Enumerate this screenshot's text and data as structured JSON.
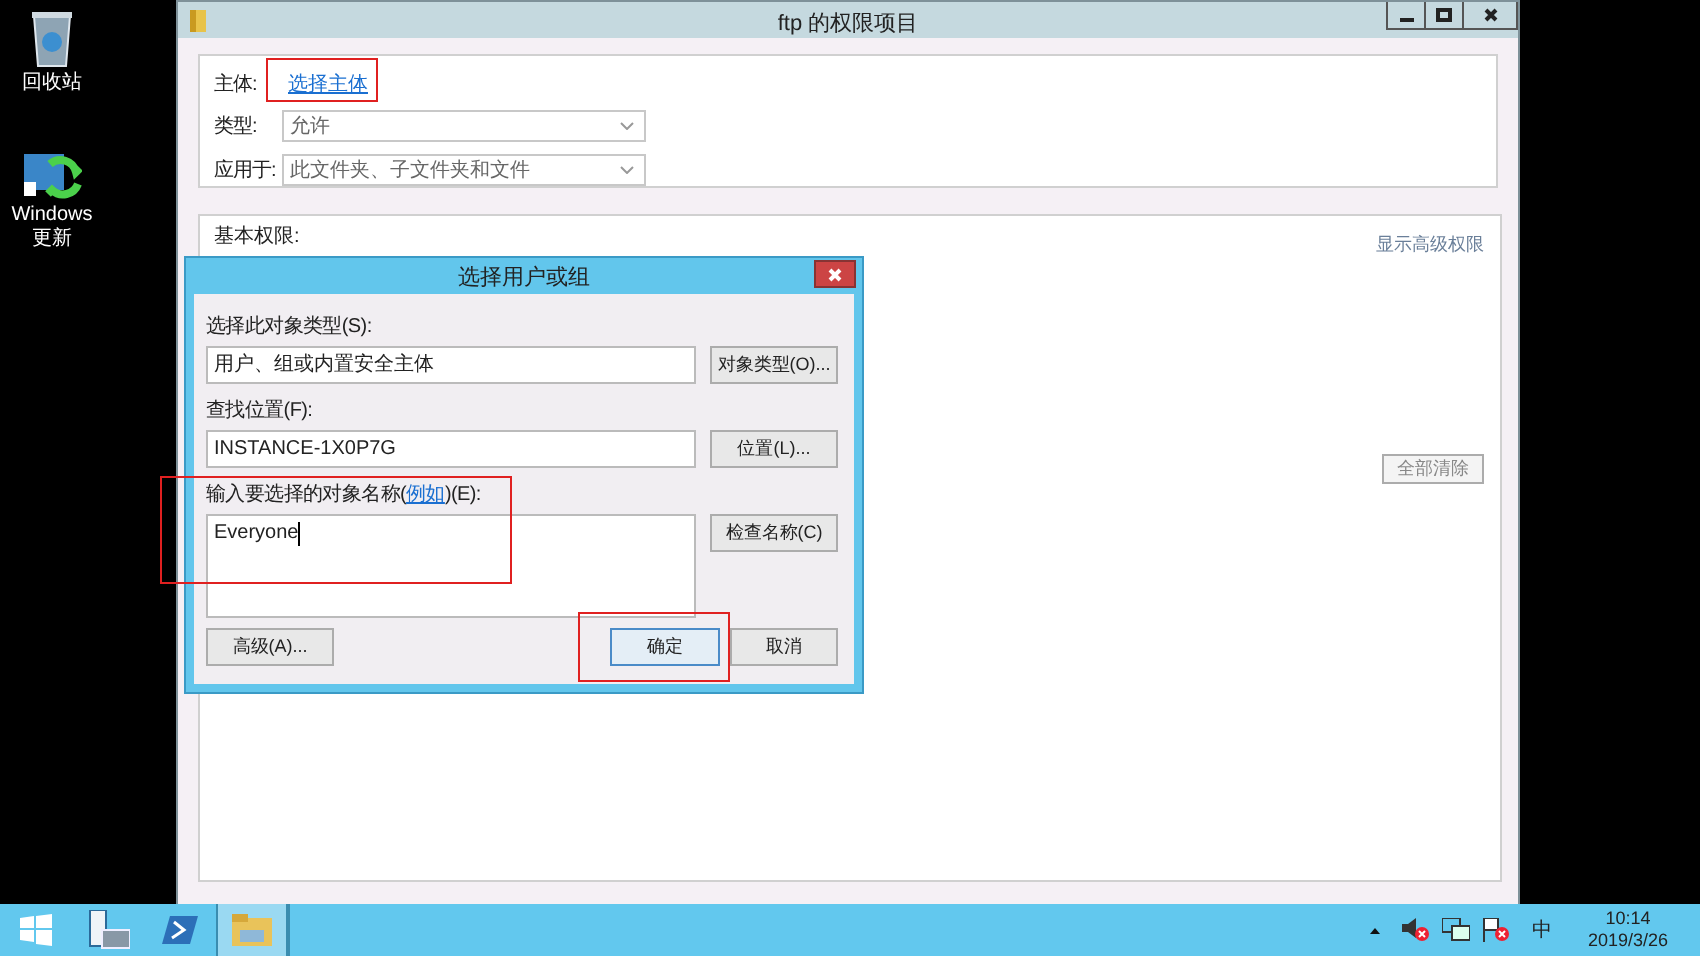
{
  "desktop_icons": [
    {
      "kind": "recycle",
      "label": "回收站"
    },
    {
      "kind": "update",
      "label": "Windows 更新"
    }
  ],
  "window": {
    "title": "ftp 的权限项目",
    "principal": {
      "label": "主体:",
      "link": "选择主体"
    },
    "fields": [
      {
        "label": "类型:",
        "value": "允许"
      },
      {
        "label": "应用于:",
        "value": "此文件夹、子文件夹和文件"
      }
    ],
    "permissions": {
      "heading": "基本权限:",
      "advanced_link": "显示高级权限",
      "clear_button": "全部清除"
    }
  },
  "dialog": {
    "title": "选择用户或组",
    "object_type": {
      "label": "选择此对象类型(S):",
      "value": "用户、组或内置安全主体",
      "button": "对象类型(O)..."
    },
    "location": {
      "label": "查找位置(F):",
      "value": "INSTANCE-1X0P7G",
      "button": "位置(L)..."
    },
    "names": {
      "label_before": "输入要选择的对象名称(",
      "label_link": "例如",
      "label_after": ")(E):",
      "value": "Everyone",
      "button": "检查名称(C)"
    },
    "buttons": [
      {
        "kind": "advanced",
        "label": "高级(A)..."
      },
      {
        "kind": "ok",
        "label": "确定"
      },
      {
        "kind": "cancel",
        "label": "取消"
      }
    ]
  },
  "taskbar": {
    "apps": [
      {
        "kind": "start",
        "selected": false
      },
      {
        "kind": "server",
        "selected": false
      },
      {
        "kind": "shell",
        "selected": false
      },
      {
        "kind": "folder",
        "selected": true
      }
    ],
    "tray": [
      {
        "kind": "caret"
      },
      {
        "kind": "speaker"
      },
      {
        "kind": "network"
      },
      {
        "kind": "flag"
      }
    ],
    "ime": "中",
    "time": "10:14",
    "date": "2019/3/26"
  }
}
